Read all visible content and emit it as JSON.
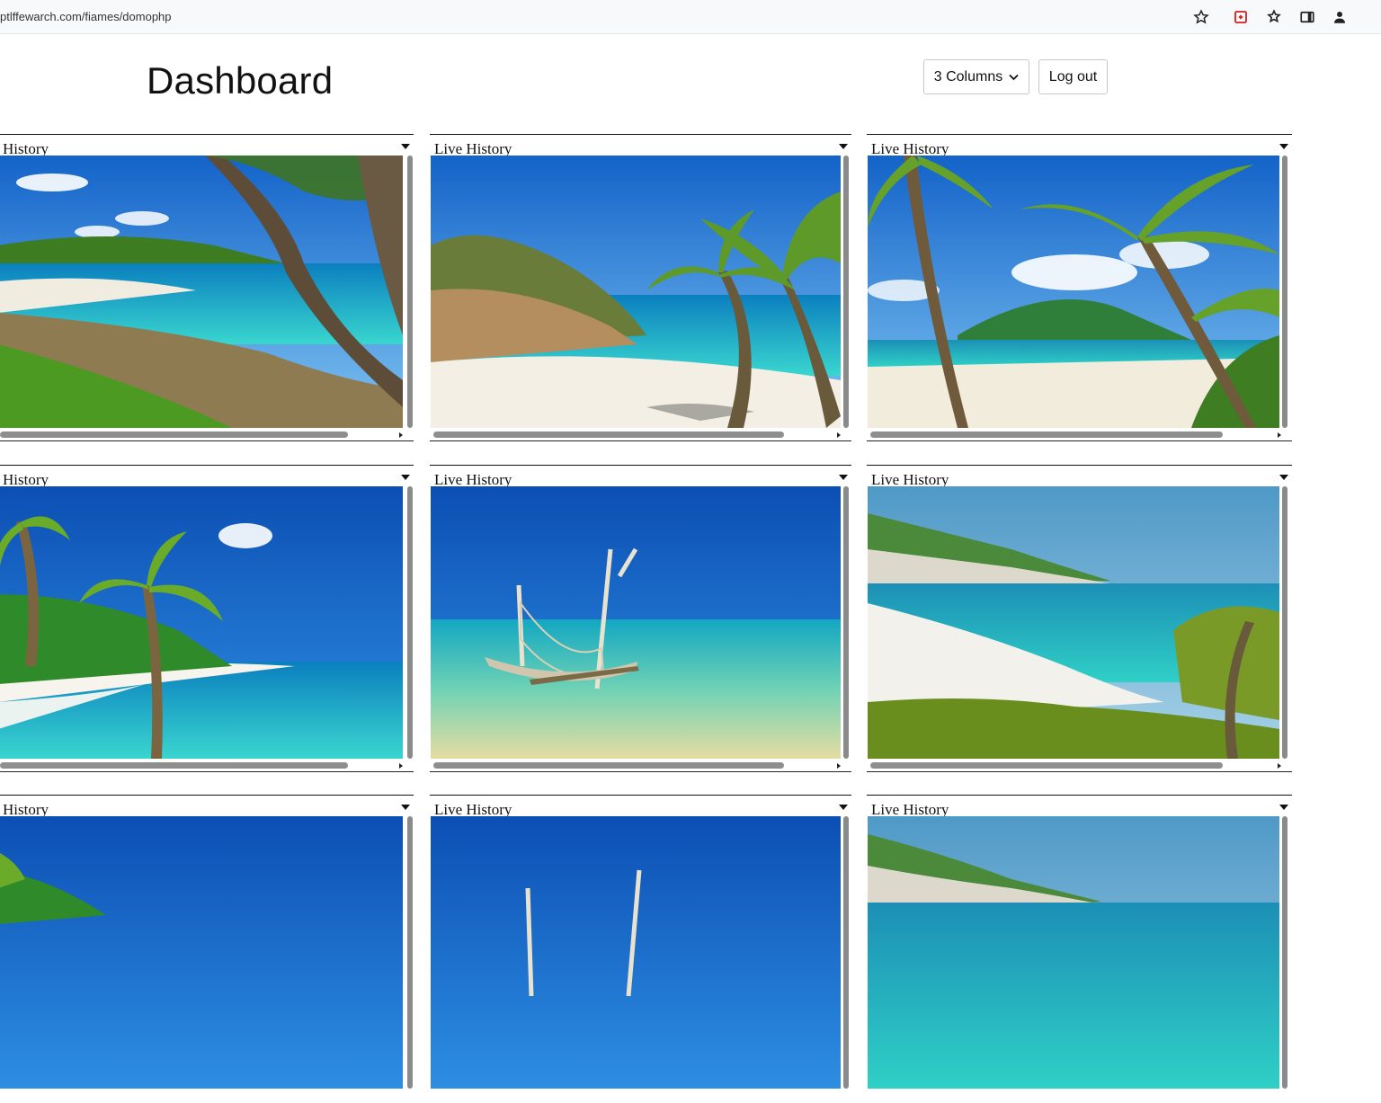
{
  "browser": {
    "url": "ptlffewarch.com/fiames/domophp",
    "icons": [
      "star-icon",
      "extension-red-icon",
      "puzzle-star-icon",
      "sidepanel-icon",
      "profile-icon"
    ]
  },
  "header": {
    "title": "Dashboard",
    "columns_button": "3 Columns",
    "logout_button": "Log out"
  },
  "panels": [
    {
      "label": "History",
      "scene": "cove-with-tree"
    },
    {
      "label": "Live History",
      "scene": "rocky-palm-beach"
    },
    {
      "label": "Live History",
      "scene": "palms-island"
    },
    {
      "label": "History",
      "scene": "palm-lagoon"
    },
    {
      "label": "Live History",
      "scene": "hammock-shallows"
    },
    {
      "label": "Live History",
      "scene": "white-cliffs-bay"
    },
    {
      "label": "History",
      "scene": "palm-lagoon"
    },
    {
      "label": "Live History",
      "scene": "hammock-shallows"
    },
    {
      "label": "Live History",
      "scene": "white-cliffs-bay"
    }
  ],
  "colors": {
    "sky": "#1f7fd8",
    "sea": "#2ec8d0",
    "sand": "#f3efe4",
    "foliage": "#4f8e1f"
  }
}
